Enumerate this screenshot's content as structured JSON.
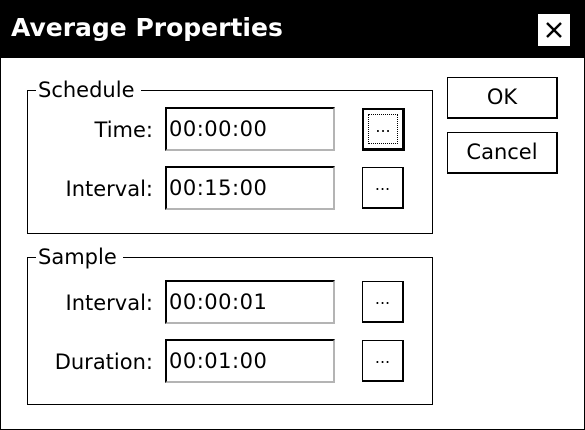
{
  "window": {
    "title": "Average Properties",
    "close_symbol": "×"
  },
  "buttons": {
    "ok_label": "OK",
    "cancel_label": "Cancel"
  },
  "schedule": {
    "legend": "Schedule",
    "time_label": "Time:",
    "time_value": "00:00:00",
    "interval_label": "Interval:",
    "interval_value": "00:15:00",
    "browse_label": "..."
  },
  "sample": {
    "legend": "Sample",
    "interval_label": "Interval:",
    "interval_value": "00:00:01",
    "duration_label": "Duration:",
    "duration_value": "00:01:00",
    "browse_label": "..."
  },
  "icons": {
    "close": "close-icon"
  }
}
